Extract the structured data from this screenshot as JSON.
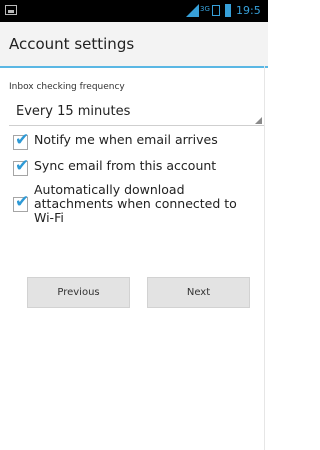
{
  "status_bar": {
    "time": "19:5",
    "network_label": "3G",
    "icons": [
      "notification-icon",
      "signal-icon",
      "network-icon",
      "sim-icon",
      "battery-icon"
    ]
  },
  "header": {
    "title": "Account settings"
  },
  "settings": {
    "frequency_label": "Inbox checking frequency",
    "frequency_value": "Every 15 minutes",
    "options": [
      {
        "label": "Notify me when email arrives",
        "checked": true
      },
      {
        "label": "Sync email from this account",
        "checked": true
      },
      {
        "label": "Automatically download attachments when connected to Wi-Fi",
        "checked": true
      }
    ]
  },
  "buttons": {
    "previous": "Previous",
    "next": "Next"
  },
  "colors": {
    "accent": "#2e9ad6",
    "status_icons": "#37a0d9",
    "divider": "#5ab7e4",
    "button_bg": "#e3e3e3"
  }
}
